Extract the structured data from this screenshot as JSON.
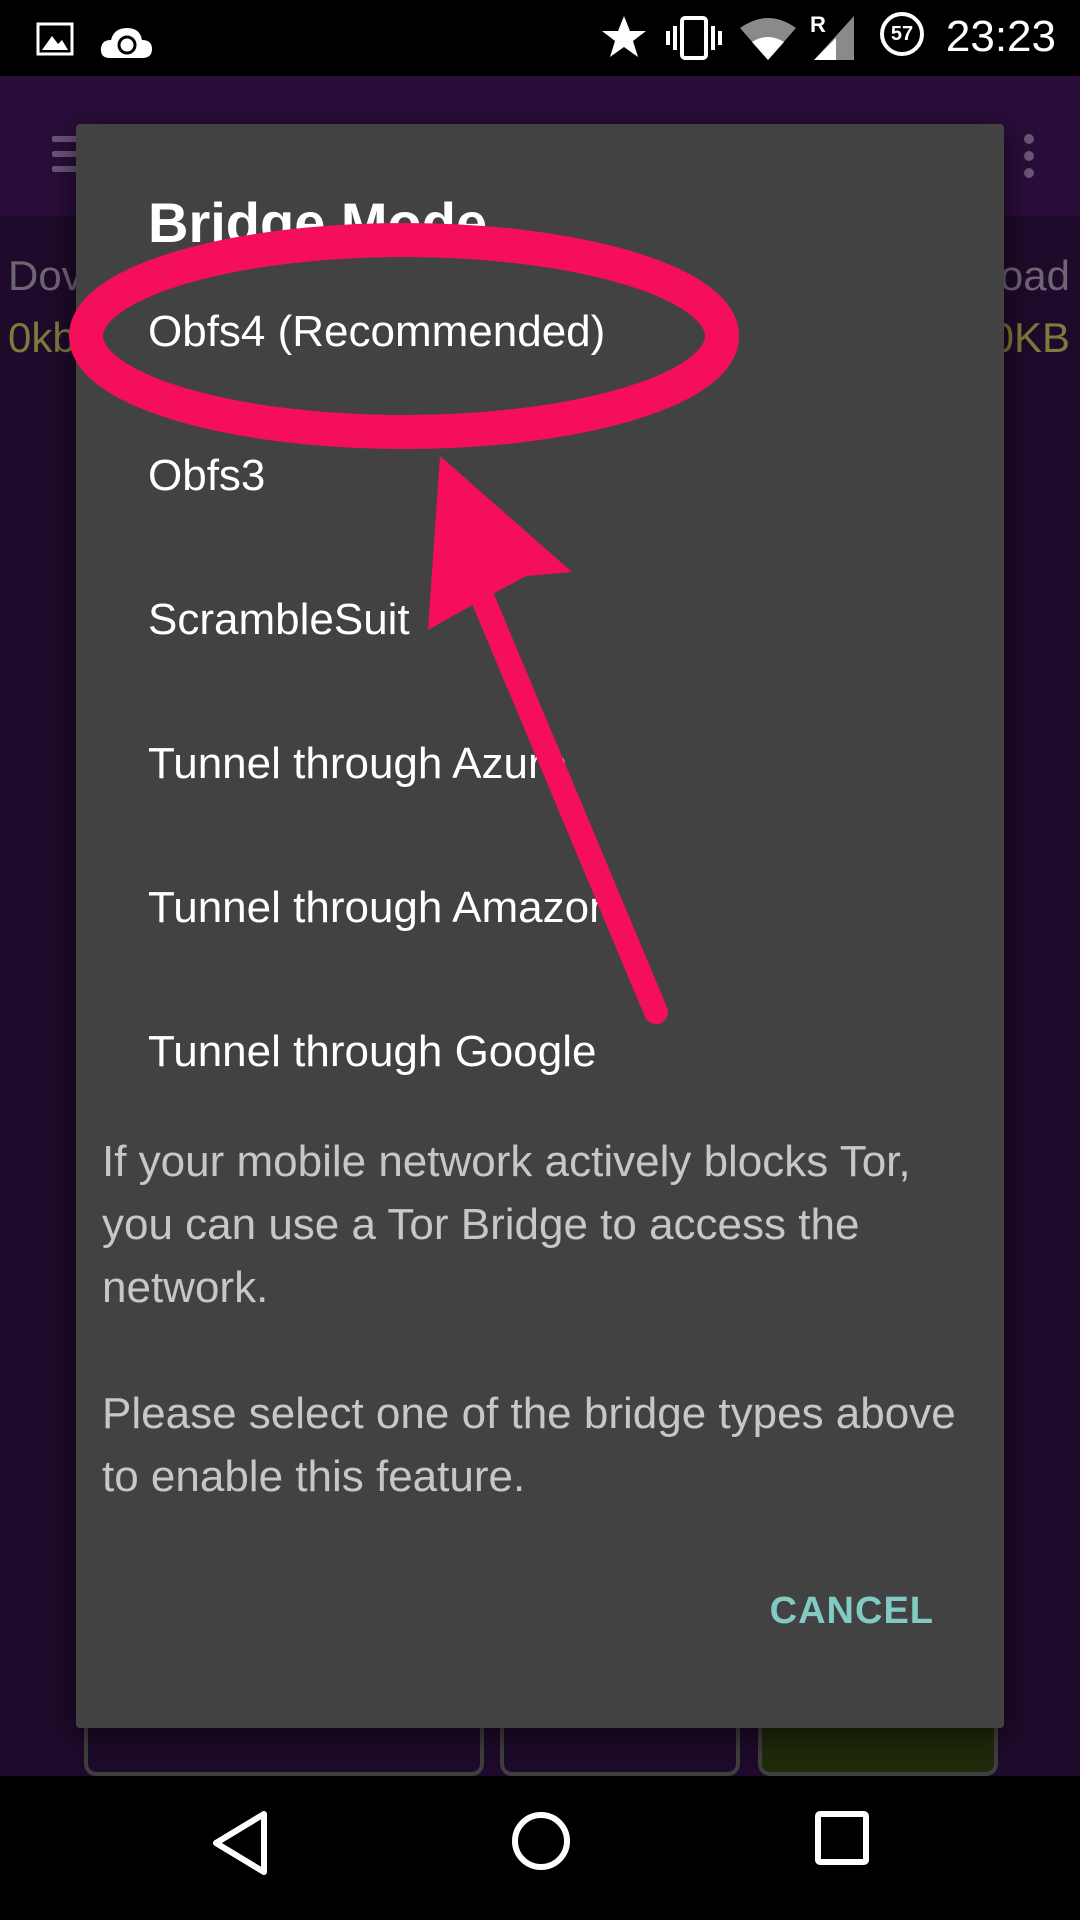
{
  "status_bar": {
    "time": "23:23",
    "battery_level": "57",
    "network_roaming": "R",
    "icons": [
      "image-icon",
      "cloud-sync-icon",
      "star-icon",
      "vibrate-icon",
      "wifi-icon",
      "signal-icon",
      "battery-icon"
    ]
  },
  "background_app": {
    "left_label": "Dov",
    "left_value": "0kb",
    "right_label": "oad",
    "right_value": "0KB"
  },
  "dialog": {
    "title": "Bridge Mode",
    "options": [
      "Obfs4 (Recommended)",
      "Obfs3",
      "ScrambleSuit",
      "Tunnel through Azure",
      "Tunnel through Amazon",
      "Tunnel through Google"
    ],
    "message_1": "If your mobile network actively blocks Tor, you can use a Tor Bridge to access the network.",
    "message_2": "Please select one of the bridge types above to enable this feature.",
    "cancel_label": "CANCEL"
  },
  "annotation": {
    "color": "#f50f5a",
    "highlighted_option": "Obfs4 (Recommended)"
  },
  "colors": {
    "dialog_bg": "#424242",
    "accent": "#80cbc4",
    "app_bg": "#1e0a2a"
  }
}
